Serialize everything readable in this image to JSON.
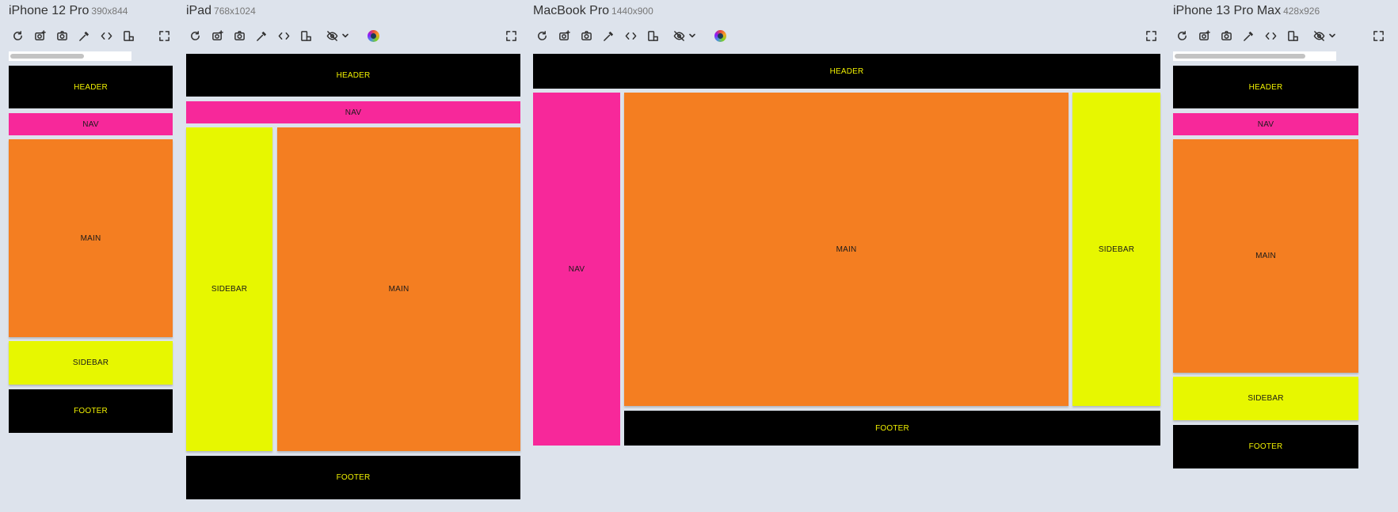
{
  "devices": [
    {
      "name": "iPhone 12 Pro",
      "size": "390x844"
    },
    {
      "name": "iPad",
      "size": "768x1024"
    },
    {
      "name": "MacBook Pro",
      "size": "1440x900"
    },
    {
      "name": "iPhone 13 Pro Max",
      "size": "428x926"
    }
  ],
  "sections": {
    "header": "HEADER",
    "nav": "NAV",
    "main": "MAIN",
    "sidebar": "SIDEBAR",
    "footer": "FOOTER"
  },
  "toolbar_icons": [
    "refresh-icon",
    "camera-plus-icon",
    "camera-icon",
    "pipette-icon",
    "code-icon",
    "rotate-device-icon",
    "eye-off-icon",
    "chevron-down-icon",
    "color-picker-icon",
    "fullscreen-icon"
  ],
  "colors": {
    "background": "#dde3ec",
    "header_footer": "#000000",
    "header_footer_text": "#f0f000",
    "nav": "#f7289a",
    "main": "#f47e21",
    "sidebar": "#e7f700"
  }
}
